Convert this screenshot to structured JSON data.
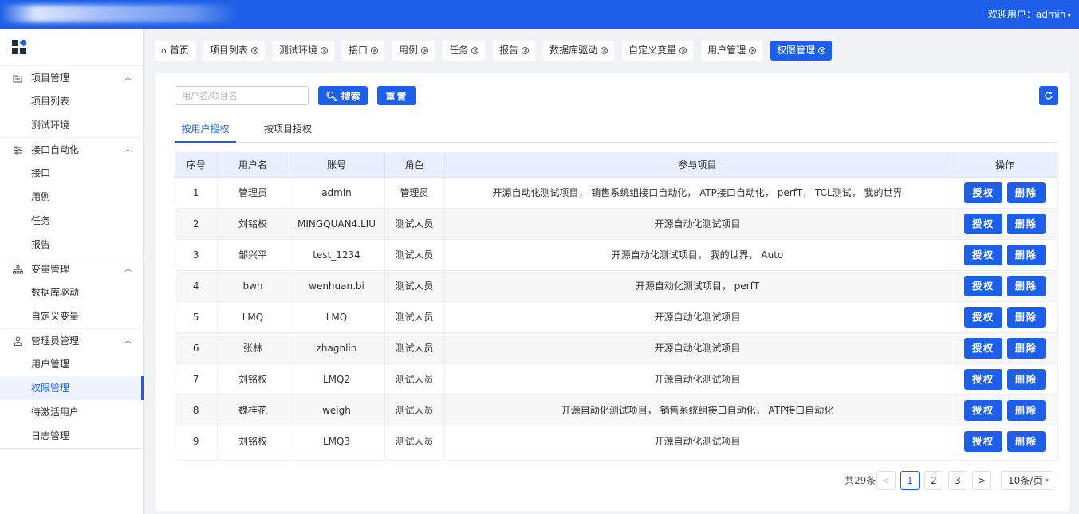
{
  "header": {
    "welcome": "欢迎用户：admin",
    "chevron": "chevron-down-icon"
  },
  "sidebar": {
    "groups": [
      {
        "label": "项目管理",
        "icon": "folder-icon",
        "items": [
          "项目列表",
          "测试环境"
        ]
      },
      {
        "label": "接口自动化",
        "icon": "sliders-icon",
        "items": [
          "接口",
          "用例",
          "任务",
          "报告"
        ]
      },
      {
        "label": "变量管理",
        "icon": "hierarchy-icon",
        "items": [
          "数据库驱动",
          "自定义变量"
        ]
      },
      {
        "label": "管理员管理",
        "icon": "user-icon",
        "items": [
          "用户管理",
          "权限管理",
          "待激活用户",
          "日志管理"
        ]
      }
    ],
    "active_item": "权限管理"
  },
  "tags": [
    "首页",
    "项目列表",
    "测试环境",
    "接口",
    "用例",
    "任务",
    "报告",
    "数据库驱动",
    "自定义变量",
    "用户管理",
    "权限管理"
  ],
  "active_tag": "权限管理",
  "search": {
    "placeholder": "用户名/项目名",
    "search_label": "搜索",
    "reset_label": "重置"
  },
  "subtabs": [
    "按用户授权",
    "按项目授权"
  ],
  "table": {
    "columns": [
      "序号",
      "用户名",
      "账号",
      "角色",
      "参与项目",
      "操作"
    ],
    "rows": [
      [
        "1",
        "管理员",
        "admin",
        "管理员",
        "开源自动化测试项目， 销售系统组接口自动化， ATP接口自动化， perfT， TCL测试， 我的世界"
      ],
      [
        "2",
        "刘铭权",
        "MINGQUAN4.LIU",
        "测试人员",
        "开源自动化测试项目"
      ],
      [
        "3",
        "邹兴平",
        "test_1234",
        "测试人员",
        "开源自动化测试项目， 我的世界， Auto"
      ],
      [
        "4",
        "bwh",
        "wenhuan.bi",
        "测试人员",
        "开源自动化测试项目， perfT"
      ],
      [
        "5",
        "LMQ",
        "LMQ",
        "测试人员",
        "开源自动化测试项目"
      ],
      [
        "6",
        "张林",
        "zhagnlin",
        "测试人员",
        "开源自动化测试项目"
      ],
      [
        "7",
        "刘铭权",
        "LMQ2",
        "测试人员",
        "开源自动化测试项目"
      ],
      [
        "8",
        "魏桂花",
        "weigh",
        "测试人员",
        "开源自动化测试项目， 销售系统组接口自动化， ATP接口自动化"
      ],
      [
        "9",
        "刘铭权",
        "LMQ3",
        "测试人员",
        "开源自动化测试项目"
      ]
    ],
    "grant_label": "授权",
    "delete_label": "删除"
  },
  "pagination": {
    "total": "共29条",
    "prev": "<",
    "next": ">",
    "pages": [
      "1",
      "2",
      "3"
    ],
    "current": "1",
    "page_size": "10条/页"
  },
  "colors": {
    "primary": "#1d5fe8"
  }
}
